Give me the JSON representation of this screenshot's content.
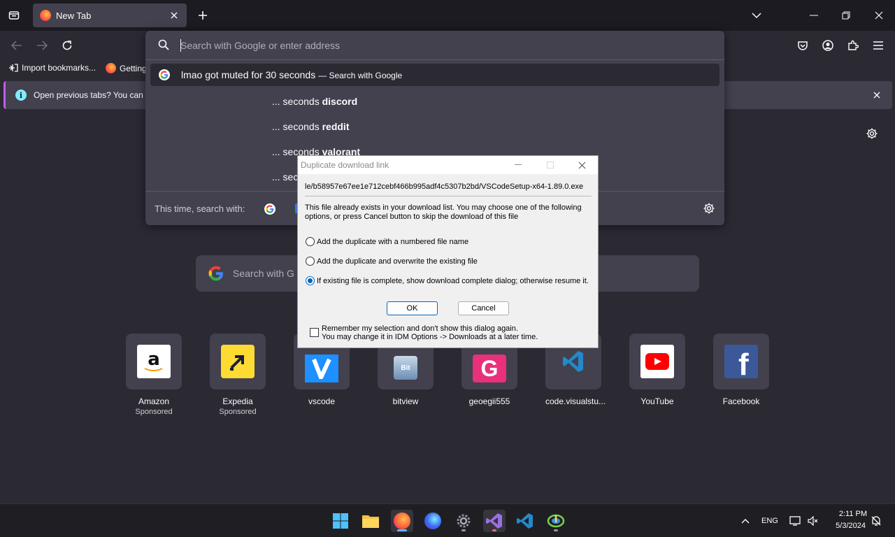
{
  "tabstrip": {
    "tab_title": "New Tab"
  },
  "bookmarks": {
    "import_label": "Import bookmarks...",
    "getting_started_label": "Getting"
  },
  "notification": {
    "message": "Open previous tabs? You can re"
  },
  "urlbar": {
    "placeholder": "Search with Google or enter address",
    "first_query": "lmao got muted for 30 seconds",
    "first_action": "— Search with Google",
    "suggestions": [
      {
        "prefix": "... seconds ",
        "bold": "discord"
      },
      {
        "prefix": "... seconds ",
        "bold": "reddit"
      },
      {
        "prefix": "... seconds ",
        "bold": "valorant"
      },
      {
        "prefix": "... seco",
        "bold": ""
      }
    ],
    "one_off_label": "This time, search with:"
  },
  "newtab": {
    "search_placeholder": "Search with G",
    "top_sites": [
      {
        "label": "Amazon",
        "sponsored": "Sponsored"
      },
      {
        "label": "Expedia",
        "sponsored": "Sponsored"
      },
      {
        "label": "vscode",
        "sponsored": ""
      },
      {
        "label": "bitview",
        "sponsored": ""
      },
      {
        "label": "geoegii555",
        "sponsored": ""
      },
      {
        "label": "code.visualstu...",
        "sponsored": ""
      },
      {
        "label": "YouTube",
        "sponsored": ""
      },
      {
        "label": "Facebook",
        "sponsored": ""
      }
    ]
  },
  "dialog": {
    "title": "Duplicate download link",
    "url": "le/b58957e67ee1e712cebf466b995adf4c5307b2bd/VSCodeSetup-x64-1.89.0.exe",
    "description": "This file already exists in your download list. You may choose one of the following options, or press Cancel button to skip the download of this file",
    "options": [
      "Add the duplicate with a numbered file name",
      "Add the duplicate and overwrite the existing file",
      "If existing file is complete, show download complete dialog; otherwise resume it."
    ],
    "selected_option": 2,
    "ok_label": "OK",
    "cancel_label": "Cancel",
    "remember_line1": "Remember my selection and don't show this dialog again.",
    "remember_line2": "You may change it in IDM Options -> Downloads at a later time."
  },
  "taskbar": {
    "lang": "ENG",
    "time": "2:11 PM",
    "date": "5/3/2024"
  },
  "colors": {
    "firefox_bg": "#2b2a33",
    "panel": "#42414d",
    "accent": "#0067c0"
  }
}
